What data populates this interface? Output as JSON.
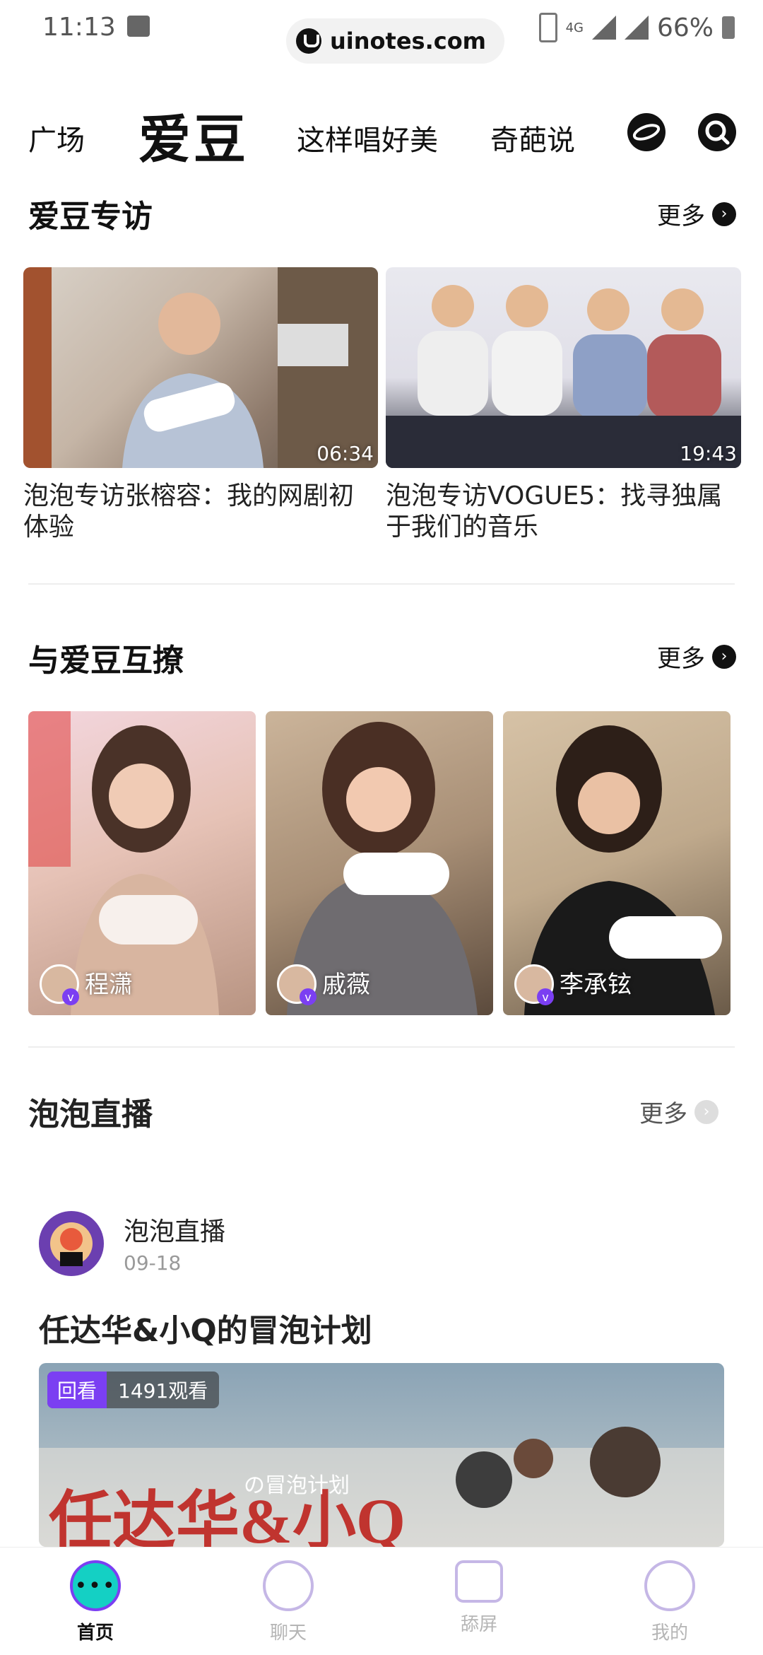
{
  "status": {
    "time": "11:13",
    "battery": "66%",
    "network": "4G"
  },
  "watermark": {
    "text": "uinotes.com"
  },
  "nav": {
    "tabs": [
      "广场",
      "爱豆",
      "这样唱好美",
      "奇葩说"
    ],
    "active": "爱豆"
  },
  "interviews": {
    "title": "爱豆专访",
    "more": "更多",
    "items": [
      {
        "duration": "06:34",
        "title": "泡泡专访张榕容：我的网剧初体验"
      },
      {
        "duration": "19:43",
        "title": "泡泡专访VOGUE5：找寻独属于我们的音乐"
      }
    ]
  },
  "interact": {
    "title": "与爱豆互撩",
    "more": "更多",
    "stars": [
      {
        "name": "程潇"
      },
      {
        "name": "戚薇"
      },
      {
        "name": "李承铉"
      }
    ]
  },
  "live": {
    "title": "泡泡直播",
    "more": "更多",
    "post": {
      "author": "泡泡直播",
      "date": "09-18",
      "headline": "任达华&小Q的冒泡计划",
      "badge": "回看",
      "views": "1491观看",
      "cover_text": "任达华&小Q",
      "cover_sub": "の冒泡计划"
    }
  },
  "bottom_nav": {
    "items": [
      "首页",
      "聊天",
      "舔屏",
      "我的"
    ],
    "active": "首页"
  },
  "colors": {
    "accent": "#7b3ff2",
    "inactive": "#b5b5b5"
  }
}
